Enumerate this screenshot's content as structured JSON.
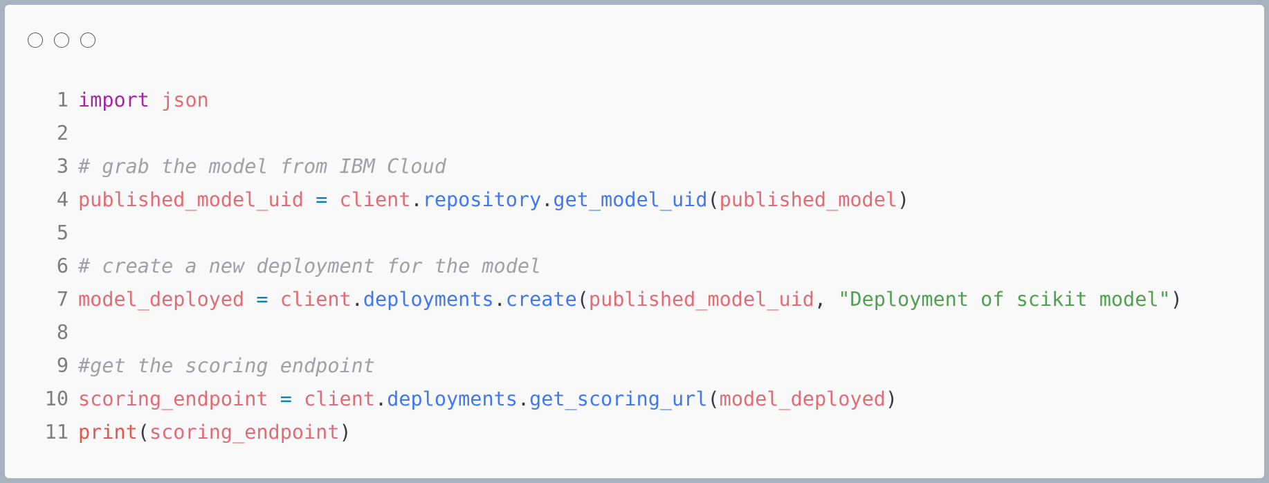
{
  "window": {
    "controls": [
      "close",
      "minimize",
      "maximize"
    ]
  },
  "code": {
    "lines": [
      {
        "n": "1",
        "tokens": [
          {
            "t": "import",
            "c": "kw"
          },
          {
            "t": " ",
            "c": "pn"
          },
          {
            "t": "json",
            "c": "id"
          }
        ]
      },
      {
        "n": "2",
        "tokens": []
      },
      {
        "n": "3",
        "tokens": [
          {
            "t": "# grab the model from IBM Cloud",
            "c": "com"
          }
        ]
      },
      {
        "n": "4",
        "tokens": [
          {
            "t": "published_model_uid",
            "c": "id"
          },
          {
            "t": " ",
            "c": "pn"
          },
          {
            "t": "=",
            "c": "op"
          },
          {
            "t": " ",
            "c": "pn"
          },
          {
            "t": "client",
            "c": "id"
          },
          {
            "t": ".",
            "c": "pn"
          },
          {
            "t": "repository",
            "c": "fn"
          },
          {
            "t": ".",
            "c": "pn"
          },
          {
            "t": "get_model_uid",
            "c": "fn"
          },
          {
            "t": "(",
            "c": "pn"
          },
          {
            "t": "published_model",
            "c": "id"
          },
          {
            "t": ")",
            "c": "pn"
          }
        ]
      },
      {
        "n": "5",
        "tokens": []
      },
      {
        "n": "6",
        "tokens": [
          {
            "t": "# create a new deployment for the model",
            "c": "com"
          }
        ]
      },
      {
        "n": "7",
        "tokens": [
          {
            "t": "model_deployed",
            "c": "id"
          },
          {
            "t": " ",
            "c": "pn"
          },
          {
            "t": "=",
            "c": "op"
          },
          {
            "t": " ",
            "c": "pn"
          },
          {
            "t": "client",
            "c": "id"
          },
          {
            "t": ".",
            "c": "pn"
          },
          {
            "t": "deployments",
            "c": "fn"
          },
          {
            "t": ".",
            "c": "pn"
          },
          {
            "t": "create",
            "c": "fn"
          },
          {
            "t": "(",
            "c": "pn"
          },
          {
            "t": "published_model_uid",
            "c": "id"
          },
          {
            "t": ", ",
            "c": "pn"
          },
          {
            "t": "\"Deployment of scikit model\"",
            "c": "str"
          },
          {
            "t": ")",
            "c": "pn"
          }
        ]
      },
      {
        "n": "8",
        "tokens": []
      },
      {
        "n": "9",
        "tokens": [
          {
            "t": "#get the scoring endpoint",
            "c": "com"
          }
        ]
      },
      {
        "n": "10",
        "tokens": [
          {
            "t": "scoring_endpoint",
            "c": "id"
          },
          {
            "t": " ",
            "c": "pn"
          },
          {
            "t": "=",
            "c": "op"
          },
          {
            "t": " ",
            "c": "pn"
          },
          {
            "t": "client",
            "c": "id"
          },
          {
            "t": ".",
            "c": "pn"
          },
          {
            "t": "deployments",
            "c": "fn"
          },
          {
            "t": ".",
            "c": "pn"
          },
          {
            "t": "get_scoring_url",
            "c": "fn"
          },
          {
            "t": "(",
            "c": "pn"
          },
          {
            "t": "model_deployed",
            "c": "id"
          },
          {
            "t": ")",
            "c": "pn"
          }
        ]
      },
      {
        "n": "11",
        "tokens": [
          {
            "t": "print",
            "c": "bi"
          },
          {
            "t": "(",
            "c": "pn"
          },
          {
            "t": "scoring_endpoint",
            "c": "id"
          },
          {
            "t": ")",
            "c": "pn"
          }
        ]
      }
    ]
  },
  "colors": {
    "keyword": "#a626a4",
    "identifier": "#e06c75",
    "function": "#4078f2",
    "operator": "#0184bc",
    "string": "#50a14f",
    "comment": "#a0a1a7",
    "builtin": "#e45649",
    "background": "#f9f9f9",
    "frame": "#a7b4c0"
  }
}
